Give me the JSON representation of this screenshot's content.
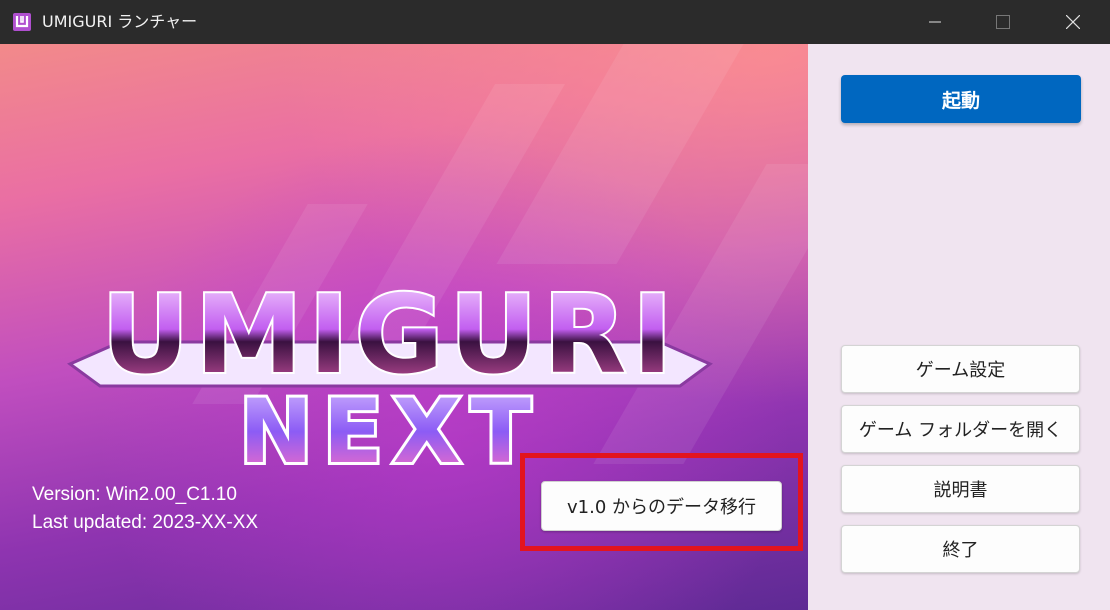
{
  "window": {
    "title": "UMIGURI ランチャー"
  },
  "hero": {
    "logo_line1": "UMIGURI",
    "logo_line2": "NEXT",
    "version_label": "Version: Win2.00_C1.10",
    "updated_label": "Last updated: 2023-XX-XX",
    "migrate_button": "v1.0 からのデータ移行",
    "highlight_color": "#e3141e"
  },
  "sidebar": {
    "launch_button": "起動",
    "game_settings_button": "ゲーム設定",
    "open_folder_button": "ゲーム フォルダーを開く",
    "manual_button": "説明書",
    "exit_button": "終了",
    "accent_color": "#0067c0"
  }
}
